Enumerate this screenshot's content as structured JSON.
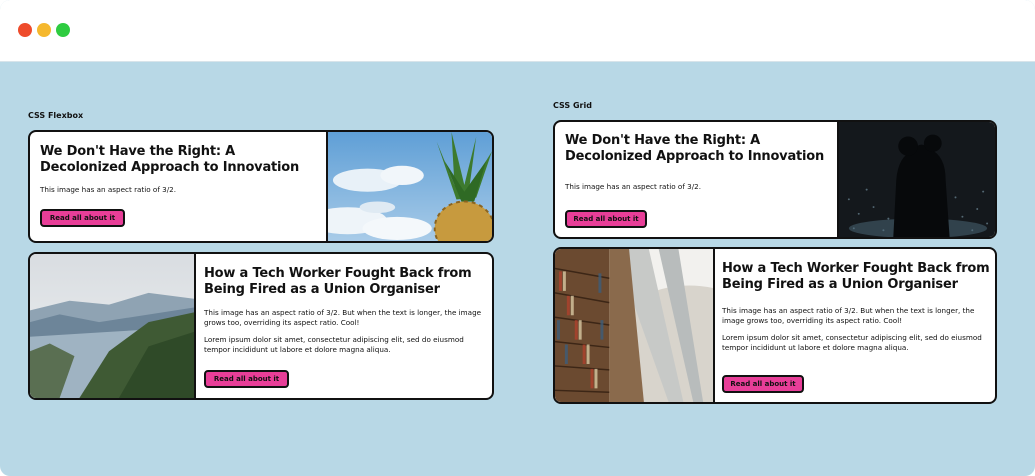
{
  "sections": {
    "flexbox": "CSS Flexbox",
    "grid": "CSS Grid"
  },
  "cards": {
    "flex1": {
      "title": "We Don't Have the Right: A Decolonized Approach to Innovation",
      "body": "This image has an aspect ratio of 3/2.",
      "button": "Read all about it"
    },
    "flex2": {
      "title": "How a Tech Worker Fought Back from Being Fired as a Union Organiser",
      "body": "This image has an aspect ratio of 3/2. But when the text is longer, the image grows too, overriding its aspect ratio. Cool!",
      "body2": "Lorem ipsum dolor sit amet, consectetur adipiscing elit, sed do eiusmod tempor incididunt ut labore et dolore magna aliqua.",
      "button": "Read all about it"
    },
    "grid1": {
      "title": "We Don't Have the Right: A Decolonized Approach to Innovation",
      "body": "This image has an aspect ratio of 3/2.",
      "button": "Read all about it"
    },
    "grid2": {
      "title": "How a Tech Worker Fought Back from Being Fired as a Union Organiser",
      "body": "This image has an aspect ratio of 3/2. But when the text is longer, the image grows too, overriding its aspect ratio. Cool!",
      "body2": "Lorem ipsum dolor sit amet, consectetur adipiscing elit, sed do eiusmod tempor incididunt ut labore et dolore magna aliqua.",
      "button": "Read all about it"
    }
  },
  "colors": {
    "background": "#b8d8e6",
    "accent": "#e83e98",
    "border": "#111111"
  },
  "icons": {
    "flex1": "pineapple-sky-photo",
    "flex2": "fjord-mountains-photo",
    "grid1": "couple-silhouette-photo",
    "grid2": "library-bookshelf-photo"
  }
}
